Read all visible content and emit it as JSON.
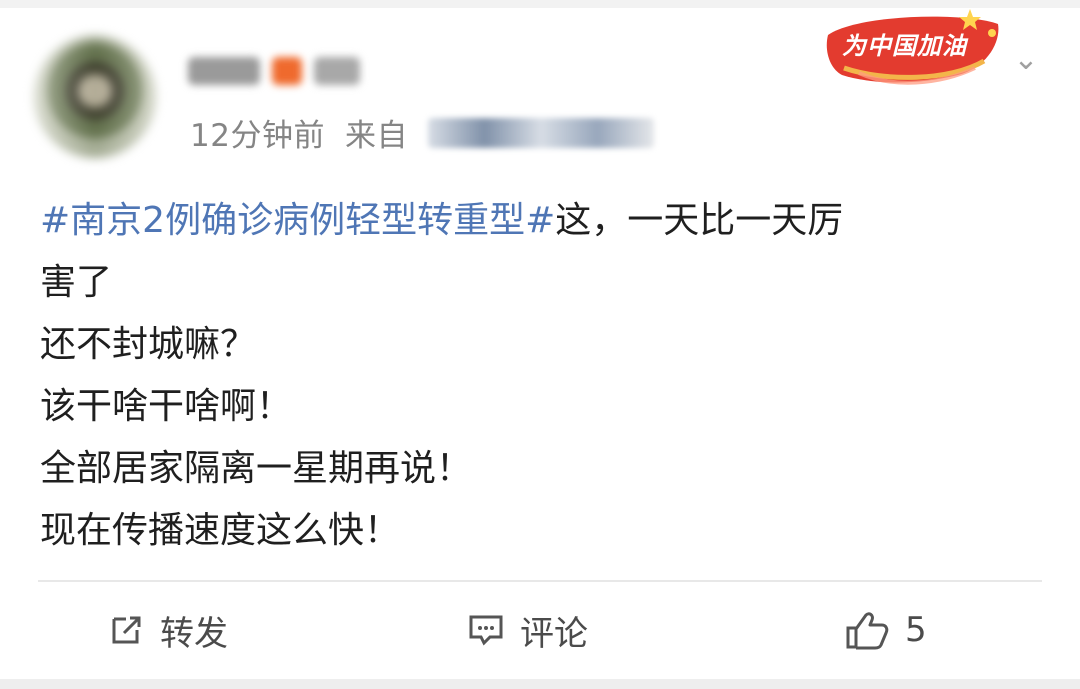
{
  "header": {
    "timestamp": "12分钟前",
    "source_prefix": "来自",
    "stamp_text": "为中国加油",
    "menu_icon": "chevron-down-icon"
  },
  "post": {
    "hashtag": "#南京2例确诊病例轻型转重型#",
    "line1_text": "这，一天比一天厉",
    "line2_text": "害了",
    "lines": [
      "还不封城嘛？",
      "该干啥干啥啊！",
      "全部居家隔离一星期再说！",
      "现在传播速度这么快！"
    ]
  },
  "actions": {
    "forward_label": "转发",
    "comment_label": "评论",
    "like_count": "5"
  },
  "colors": {
    "hashtag": "#4f76b5",
    "stamp_red": "#e33b2f",
    "text_gray": "#858585"
  }
}
